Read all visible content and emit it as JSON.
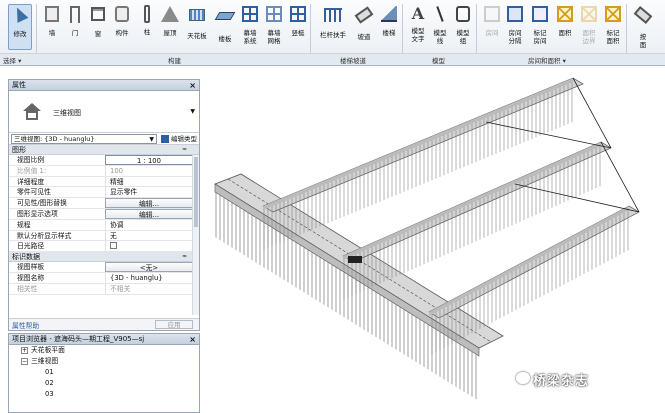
{
  "ribbon": {
    "tools": [
      {
        "label": "修改",
        "sub": "",
        "icon": "modify-cursor-icon"
      },
      {
        "label": "墙",
        "sub": "",
        "icon": "wall-icon"
      },
      {
        "label": "门",
        "sub": "",
        "icon": "door-icon"
      },
      {
        "label": "窗",
        "sub": "",
        "icon": "window-icon"
      },
      {
        "label": "构件",
        "sub": "",
        "icon": "component-icon"
      },
      {
        "label": "柱",
        "sub": "",
        "icon": "column-icon"
      },
      {
        "label": "屋顶",
        "sub": "",
        "icon": "roof-icon"
      },
      {
        "label": "天花板",
        "sub": "",
        "icon": "ceiling-icon"
      },
      {
        "label": "楼板",
        "sub": "",
        "icon": "floor-icon"
      },
      {
        "label": "幕墙",
        "sub": "系统",
        "icon": "curtain-system-icon"
      },
      {
        "label": "幕墙",
        "sub": "网格",
        "icon": "curtain-grid-icon"
      },
      {
        "label": "竖梃",
        "sub": "",
        "icon": "mullion-icon"
      },
      {
        "label": "栏杆扶手",
        "sub": "",
        "icon": "railing-icon"
      },
      {
        "label": "坡道",
        "sub": "",
        "icon": "ramp-icon"
      },
      {
        "label": "楼梯",
        "sub": "",
        "icon": "stair-icon"
      },
      {
        "label": "模型",
        "sub": "文字",
        "icon": "model-text-icon"
      },
      {
        "label": "模型",
        "sub": "线",
        "icon": "model-line-icon"
      },
      {
        "label": "模型",
        "sub": "组",
        "icon": "model-group-icon"
      },
      {
        "label": "房间",
        "sub": "",
        "icon": "room-icon"
      },
      {
        "label": "房间",
        "sub": "分隔",
        "icon": "room-separator-icon"
      },
      {
        "label": "标记",
        "sub": "房间",
        "icon": "tag-room-icon"
      },
      {
        "label": "面积",
        "sub": "",
        "icon": "area-icon"
      },
      {
        "label": "面积",
        "sub": "边界",
        "icon": "area-boundary-icon"
      },
      {
        "label": "标记",
        "sub": "面积",
        "icon": "tag-area-icon"
      },
      {
        "label": "按",
        "sub": "面",
        "icon": "by-face-icon"
      }
    ],
    "panels": {
      "select": "选择 ▾",
      "build": "构建",
      "circulation": "楼梯坡道",
      "model": "模型",
      "room_area": "房间和面积 ▾"
    }
  },
  "properties": {
    "title": "属性",
    "close": "×",
    "type_name": "三维视图",
    "instance_selector": "三维视图: {3D - huanglu}",
    "edit_type": "编辑类型",
    "sections": {
      "graphics": "图形",
      "identity": "标识数据",
      "collapse": "≈"
    },
    "rows_graphics": [
      {
        "k": "视图比例",
        "v": "1 : 100"
      },
      {
        "k": "比例值 1:",
        "v": "100"
      },
      {
        "k": "详细程度",
        "v": "精细"
      },
      {
        "k": "零件可见性",
        "v": "显示零件"
      },
      {
        "k": "可见性/图形替换",
        "v": "编辑..."
      },
      {
        "k": "图形显示选项",
        "v": "编辑..."
      },
      {
        "k": "规程",
        "v": "协调"
      },
      {
        "k": "默认分析显示样式",
        "v": "无"
      },
      {
        "k": "日光路径",
        "v": ""
      }
    ],
    "rows_identity": [
      {
        "k": "视图样板",
        "v": "<无>"
      },
      {
        "k": "视图名称",
        "v": "{3D - huanglu}"
      },
      {
        "k": "相关性",
        "v": "不相关"
      }
    ],
    "help_link": "属性帮助",
    "apply": "应用"
  },
  "browser": {
    "title": "项目浏览器 - 遮海码头—期工程_V905—sj",
    "close": "×",
    "items": [
      {
        "label": "天花板平面",
        "exp": "+",
        "level": 1
      },
      {
        "label": "三维视图",
        "exp": "−",
        "level": 1
      },
      {
        "label": "01",
        "exp": "",
        "level": 2
      },
      {
        "label": "02",
        "exp": "",
        "level": 2
      },
      {
        "label": "03",
        "exp": "",
        "level": 2
      }
    ]
  },
  "watermark": "桥梁杂志",
  "colors": {
    "accent": "#2f5fa0",
    "ribbon_bg": "#e9eef4",
    "panel_border": "#9aa6b6"
  }
}
